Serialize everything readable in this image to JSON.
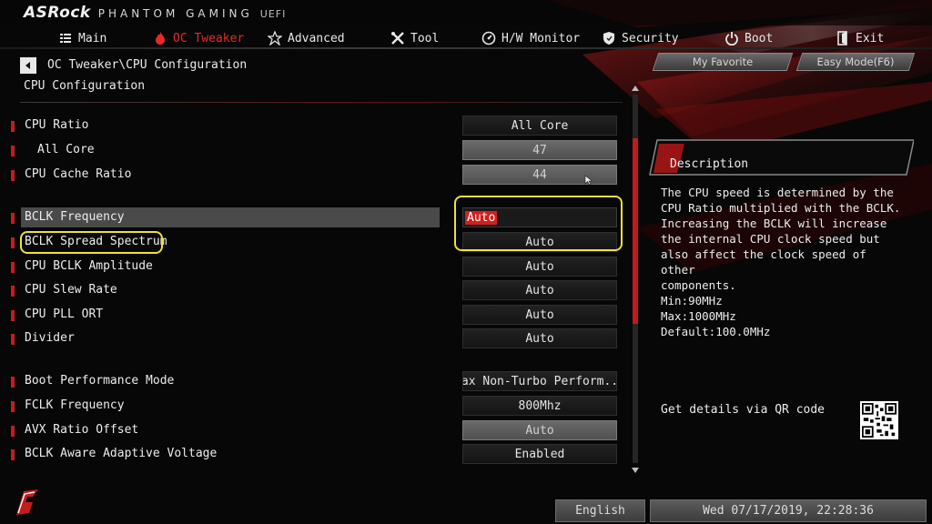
{
  "brand": {
    "logo": "ASRock",
    "subtitle": "PHANTOM GAMING",
    "uefi": "UEFI"
  },
  "nav": {
    "items": [
      {
        "label": "Main",
        "icon": "list-icon",
        "active": false
      },
      {
        "label": "OC Tweaker",
        "icon": "flame-icon",
        "active": true
      },
      {
        "label": "Advanced",
        "icon": "star-icon",
        "active": false
      },
      {
        "label": "Tool",
        "icon": "tools-icon",
        "active": false
      },
      {
        "label": "H/W Monitor",
        "icon": "gauge-icon",
        "active": false
      },
      {
        "label": "Security",
        "icon": "shield-icon",
        "active": false
      },
      {
        "label": "Boot",
        "icon": "power-icon",
        "active": false
      },
      {
        "label": "Exit",
        "icon": "exit-icon",
        "active": false
      }
    ]
  },
  "header": {
    "breadcrumb": "OC Tweaker\\CPU Configuration",
    "title": "CPU Configuration",
    "my_favorite": "My Favorite",
    "easy_mode": "Easy Mode(F6)"
  },
  "settings": [
    {
      "label": "CPU Ratio",
      "value": "All Core",
      "style": "dark",
      "marker": true
    },
    {
      "label": "All Core",
      "value": "47",
      "style": "light",
      "marker": true,
      "sub": true
    },
    {
      "label": "CPU Cache Ratio",
      "value": "44",
      "style": "light",
      "marker": true
    },
    {
      "label": "BCLK Frequency",
      "value": "Auto",
      "style": "editing",
      "marker": true,
      "selected": true
    },
    {
      "label": "BCLK Spread Spectrum",
      "value": "Auto",
      "style": "dark",
      "marker": true
    },
    {
      "label": "CPU BCLK Amplitude",
      "value": "Auto",
      "style": "dark",
      "marker": true
    },
    {
      "label": "CPU Slew Rate",
      "value": "Auto",
      "style": "dark",
      "marker": true
    },
    {
      "label": "CPU PLL ORT",
      "value": "Auto",
      "style": "dark",
      "marker": true
    },
    {
      "label": "Divider",
      "value": "Auto",
      "style": "dark",
      "marker": true
    },
    {
      "label": "Boot Performance Mode",
      "value": "Max Non-Turbo Perform...",
      "style": "dark",
      "marker": true
    },
    {
      "label": "FCLK Frequency",
      "value": "800Mhz",
      "style": "dark",
      "marker": true
    },
    {
      "label": "AVX Ratio Offset",
      "value": "Auto",
      "style": "light",
      "marker": true
    },
    {
      "label": "BCLK Aware Adaptive Voltage",
      "value": "Enabled",
      "style": "dark",
      "marker": true
    }
  ],
  "scroll": {
    "position_fraction": 0.12,
    "visible_fraction": 0.5
  },
  "description": {
    "title": "Description",
    "text": "The CPU speed is determined by the\nCPU Ratio multiplied with the BCLK.\nIncreasing the BCLK will increase\nthe internal CPU clock speed but\nalso affect the clock speed of other\ncomponents.\nMin:90MHz\nMax:1000MHz\nDefault:100.0MHz",
    "qr_label": "Get details via QR code"
  },
  "footer": {
    "language": "English",
    "datetime": "Wed 07/17/2019, 22:28:36"
  },
  "colors": {
    "accent": "#c41c1c",
    "active_tab": "#e52a2a",
    "highlight": "#f0e03a"
  }
}
